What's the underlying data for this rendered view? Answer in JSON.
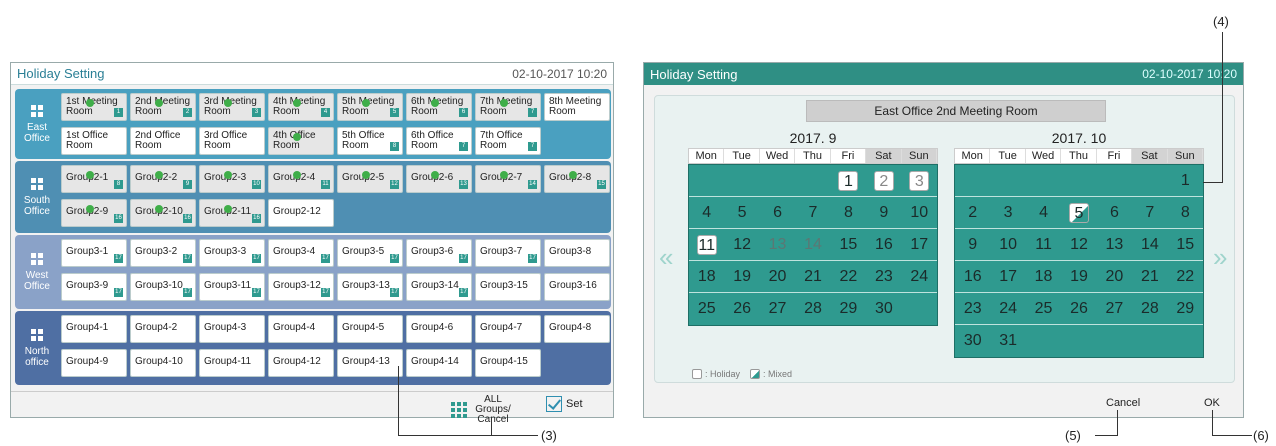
{
  "left": {
    "title": "Holiday Setting",
    "datetime": "02-10-2017  10:20",
    "offices": [
      {
        "name": "East\nOffice",
        "color": "#4aa0c0"
      },
      {
        "name": "South\nOffice",
        "color": "#4f8fb3"
      },
      {
        "name": "West\nOffice",
        "color": "#8aa2c8"
      },
      {
        "name": "North\noffice",
        "color": "#4f6fa3"
      }
    ],
    "tiles": {
      "e1": "1st Meeting Room",
      "e2": "2nd Meeting Room",
      "e3": "3rd Meeting Room",
      "e4": "4th Meeting Room",
      "e5": "5th Meeting Room",
      "e6": "6th Meeting Room",
      "e7": "7th Meeting Room",
      "e8": "8th Meeting Room",
      "e9": "1st Office Room",
      "e10": "2nd Office Room",
      "e11": "3rd Office Room",
      "e12": "4th Office Room",
      "e13": "5th Office Room",
      "e14": "6th Office Room",
      "e15": "7th Office Room",
      "s1": "Group2-1",
      "s2": "Group2-2",
      "s3": "Group2-3",
      "s4": "Group2-4",
      "s5": "Group2-5",
      "s6": "Group2-6",
      "s7": "Group2-7",
      "s8": "Group2-8",
      "s9": "Group2-9",
      "s10": "Group2-10",
      "s11": "Group2-11",
      "s12": "Group2-12",
      "w1": "Group3-1",
      "w2": "Group3-2",
      "w3": "Group3-3",
      "w4": "Group3-4",
      "w5": "Group3-5",
      "w6": "Group3-6",
      "w7": "Group3-7",
      "w8": "Group3-8",
      "w9": "Group3-9",
      "w10": "Group3-10",
      "w11": "Group3-11",
      "w12": "Group3-12",
      "w13": "Group3-13",
      "w14": "Group3-14",
      "w15": "Group3-15",
      "w16": "Group3-16",
      "n1": "Group4-1",
      "n2": "Group4-2",
      "n3": "Group4-3",
      "n4": "Group4-4",
      "n5": "Group4-5",
      "n6": "Group4-6",
      "n7": "Group4-7",
      "n8": "Group4-8",
      "n9": "Group4-9",
      "n10": "Group4-10",
      "n11": "Group4-11",
      "n12": "Group4-12",
      "n13": "Group4-13",
      "n14": "Group4-14",
      "n15": "Group4-15"
    },
    "badges": {
      "e1": "1",
      "e2": "2",
      "e3": "3",
      "e4": "4",
      "e5": "5",
      "e6": "6",
      "e7": "7",
      "e13": "8",
      "e14": "7",
      "e15": "7",
      "s1": "8",
      "s2": "9",
      "s3": "10",
      "s4": "11",
      "s5": "12",
      "s6": "13",
      "s7": "14",
      "s8": "15",
      "s9": "16",
      "s10": "16",
      "s11": "16",
      "w1": "17",
      "w2": "17",
      "w3": "17",
      "w4": "17",
      "w5": "17",
      "w6": "17",
      "w7": "17",
      "w9": "17",
      "w10": "17",
      "w11": "17",
      "w12": "17",
      "w13": "17",
      "w14": "17"
    },
    "all_groups_label": "ALL Groups/ Cancel",
    "set_label": "Set"
  },
  "right": {
    "title": "Holiday Setting",
    "datetime": "02-10-2017  10:20",
    "room": "East Office 2nd Meeting Room",
    "weekdays": [
      "Mon",
      "Tue",
      "Wed",
      "Thu",
      "Fri",
      "Sat",
      "Sun"
    ],
    "sep": {
      "label": "2017. 9",
      "rows": [
        [
          "",
          "",
          "",
          "",
          "1",
          "2",
          "3"
        ],
        [
          "4",
          "5",
          "6",
          "7",
          "8",
          "9",
          "10"
        ],
        [
          "11",
          "12",
          "13",
          "14",
          "15",
          "16",
          "17"
        ],
        [
          "18",
          "19",
          "20",
          "21",
          "22",
          "23",
          "24"
        ],
        [
          "25",
          "26",
          "27",
          "28",
          "29",
          "30",
          ""
        ]
      ]
    },
    "oct": {
      "label": "2017. 10",
      "rows": [
        [
          "",
          "",
          "",
          "",
          "",
          "",
          "1"
        ],
        [
          "2",
          "3",
          "4",
          "5",
          "6",
          "7",
          "8"
        ],
        [
          "9",
          "10",
          "11",
          "12",
          "13",
          "14",
          "15"
        ],
        [
          "16",
          "17",
          "18",
          "19",
          "20",
          "21",
          "22"
        ],
        [
          "23",
          "24",
          "25",
          "26",
          "27",
          "28",
          "29"
        ],
        [
          "30",
          "31",
          "",
          "",
          "",
          "",
          ""
        ]
      ]
    },
    "legend_holiday": ": Holiday",
    "legend_mixed": ": Mixed",
    "cancel_label": "Cancel",
    "ok_label": "OK",
    "prev_arrow": "«",
    "next_arrow": "»"
  },
  "callouts": {
    "c3": "(3)",
    "c4": "(4)",
    "c5": "(5)",
    "c6": "(6)"
  }
}
